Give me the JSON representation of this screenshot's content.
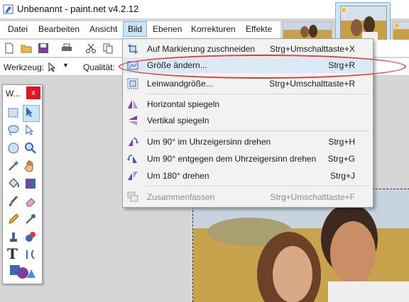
{
  "window": {
    "title": "Unbenannt - paint.net v4.2.12",
    "app_icon": "paint-net-icon"
  },
  "menubar": {
    "items": [
      {
        "id": "datei",
        "label": "Datei"
      },
      {
        "id": "bearbeiten",
        "label": "Bearbeiten"
      },
      {
        "id": "ansicht",
        "label": "Ansicht"
      },
      {
        "id": "bild",
        "label": "Bild",
        "active": true
      },
      {
        "id": "ebenen",
        "label": "Ebenen"
      },
      {
        "id": "korrekturen",
        "label": "Korrekturen"
      },
      {
        "id": "effekte",
        "label": "Effekte"
      }
    ]
  },
  "toolbar": {
    "icons": [
      "new-file-icon",
      "open-folder-icon",
      "save-icon",
      "print-icon",
      "cut-icon",
      "copy-icon"
    ]
  },
  "tool_options": {
    "tool_label": "Werkzeug:",
    "quality_label": "Qualität:"
  },
  "tools_window": {
    "title": "W...",
    "close": "x"
  },
  "image_menu": {
    "items": [
      {
        "label": "Auf Markierung zuschneiden",
        "shortcut": "Strg+Umschalttaste+X",
        "icon": "crop-icon"
      },
      {
        "label": "Größe ändern...",
        "shortcut": "Strg+R",
        "icon": "resize-icon",
        "hovered": true
      },
      {
        "label": "Leinwandgröße...",
        "shortcut": "Strg+Umschalttaste+R",
        "icon": "canvas-size-icon"
      },
      {
        "label": "Horizontal spiegeln",
        "shortcut": "",
        "icon": "flip-horizontal-icon"
      },
      {
        "label": "Vertikal spiegeln",
        "shortcut": "",
        "icon": "flip-vertical-icon"
      },
      {
        "label": "Um 90° im Uhrzeigersinn drehen",
        "shortcut": "Strg+H",
        "icon": "rotate-cw-icon"
      },
      {
        "label": "Um 90° entgegen dem Uhrzeigersinn drehen",
        "shortcut": "Strg+G",
        "icon": "rotate-ccw-icon"
      },
      {
        "label": "Um 180° drehen",
        "shortcut": "Strg+J",
        "icon": "rotate-180-icon"
      },
      {
        "label": "Zusammenfassen",
        "shortcut": "Strg+Umschalttaste+F",
        "icon": "flatten-icon",
        "disabled": true
      }
    ]
  },
  "colors": {
    "accent": "#7fb6e8",
    "highlight_ring": "#e53935",
    "close_button": "#e81123"
  }
}
